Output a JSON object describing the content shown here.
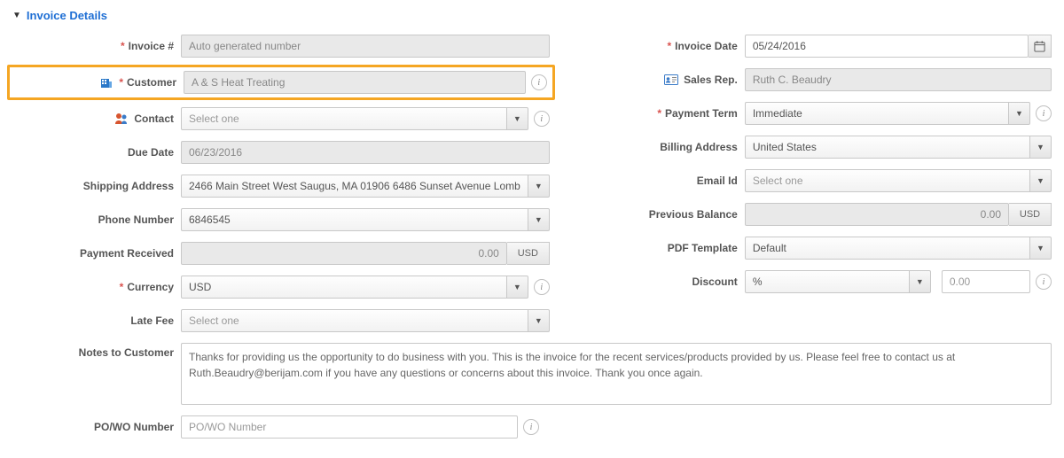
{
  "section_title": "Invoice Details",
  "labels": {
    "invoice_no": "Invoice #",
    "customer": "Customer",
    "contact": "Contact",
    "due_date": "Due Date",
    "shipping_address": "Shipping Address",
    "phone": "Phone Number",
    "payment_received": "Payment Received",
    "currency": "Currency",
    "late_fee": "Late Fee",
    "invoice_date": "Invoice Date",
    "sales_rep": "Sales Rep.",
    "payment_term": "Payment Term",
    "billing_address": "Billing Address",
    "email": "Email Id",
    "prev_balance": "Previous Balance",
    "pdf_template": "PDF Template",
    "discount": "Discount",
    "notes": "Notes to Customer",
    "po": "PO/WO Number"
  },
  "values": {
    "invoice_no": "Auto generated number",
    "customer": "A & S Heat Treating",
    "contact": "Select one",
    "due_date": "06/23/2016",
    "shipping_address": "2466 Main Street West Saugus, MA 01906 6486 Sunset Avenue Lomb",
    "phone": "6846545",
    "payment_received": "0.00",
    "payment_received_unit": "USD",
    "currency": "USD",
    "late_fee": "Select one",
    "invoice_date": "05/24/2016",
    "sales_rep": "Ruth C. Beaudry",
    "payment_term": "Immediate",
    "billing_address": "United States",
    "email": "Select one",
    "prev_balance": "0.00",
    "prev_balance_unit": "USD",
    "pdf_template": "Default",
    "discount_mode": "%",
    "discount_value": "0.00",
    "notes": "Thanks for providing us the opportunity to do business with you. This is the invoice for the recent services/products provided by us. Please feel free to contact us at Ruth.Beaudry@berijam.com if you have any questions or concerns about this invoice. Thank you once again.",
    "po_placeholder": "PO/WO Number"
  },
  "glyphs": {
    "caret_down": "▼",
    "info": "i",
    "calendar": "📅"
  }
}
